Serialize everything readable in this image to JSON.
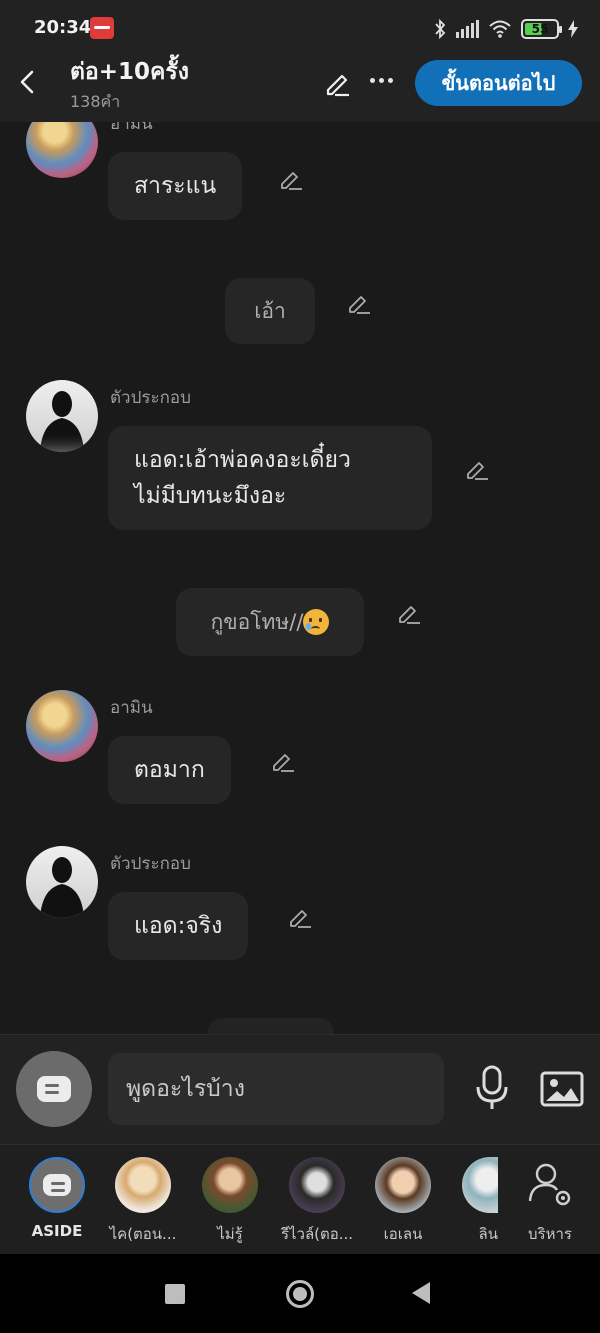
{
  "status_bar": {
    "time": "20:34",
    "app_icon": "mangatoon-app-icon",
    "battery_level": "55",
    "battery_fraction": 0.55,
    "icons": [
      "bluetooth-icon",
      "signal-icon",
      "wifi-icon",
      "battery-icon",
      "charging-icon"
    ]
  },
  "header": {
    "back_icon": "chevron-left-icon",
    "title": "ต่อ+10ครั้ง",
    "word_count": "138คำ",
    "edit_icon": "pencil-icon",
    "more_icon": "more-dots-icon",
    "next_label": "ขั้นตอนต่อไป"
  },
  "messages": [
    {
      "type": "character",
      "name": "อามิน",
      "avatar": "anime-avatar",
      "text": "สาระแน"
    },
    {
      "type": "aside",
      "text": "เอ้า"
    },
    {
      "type": "character",
      "name": "ตัวประกอบ",
      "avatar": "silhouette-avatar",
      "lines": [
        "แอด:เอ้าพ่อคงอะเดี๋ยว",
        "ไม่มีบทนะมึงอะ"
      ]
    },
    {
      "type": "aside",
      "text": "กูขอโทษ//",
      "emoji": "crying-face-emoji"
    },
    {
      "type": "character",
      "name": "อามิน",
      "avatar": "anime-avatar",
      "text": "ตอมาก"
    },
    {
      "type": "character",
      "name": "ตัวประกอบ",
      "avatar": "silhouette-avatar",
      "text": "แอด:จริง"
    }
  ],
  "composer": {
    "placeholder": "พูดอะไรบ้าง",
    "aside_icon": "message-icon",
    "mic_icon": "microphone-icon",
    "image_icon": "image-icon"
  },
  "characters": [
    {
      "label": "ASIDE"
    },
    {
      "label": "ไค(ตอน..."
    },
    {
      "label": "ไม่รู้"
    },
    {
      "label": "รีไวล์(ตอ..."
    },
    {
      "label": "เอเลน"
    },
    {
      "label": "ลิน"
    },
    {
      "label": "บริหาร"
    }
  ],
  "colors": {
    "background": "#1a1a1a",
    "bubble": "#262626",
    "accent": "#1270b8",
    "battery_green": "#55d055"
  }
}
